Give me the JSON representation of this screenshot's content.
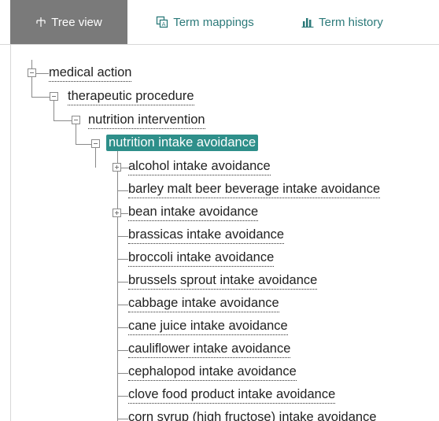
{
  "tabs": [
    {
      "label": "Tree view",
      "icon": "tree-icon",
      "active": true
    },
    {
      "label": "Term mappings",
      "icon": "mapping-icon",
      "active": false
    },
    {
      "label": "Term history",
      "icon": "history-chart-icon",
      "active": false
    }
  ],
  "colors": {
    "active_tab_bg": "#7a7a7a",
    "tab_text": "#2c7a7a",
    "selected_bg": "#2e8f8a"
  },
  "tree": {
    "ancestors": [
      "medical action",
      "therapeutic procedure",
      "nutrition intervention"
    ],
    "selected": "nutrition intake avoidance",
    "children": [
      {
        "label": "alcohol intake avoidance",
        "expandable": true
      },
      {
        "label": "barley malt beer beverage intake avoidance",
        "expandable": false
      },
      {
        "label": "bean intake avoidance",
        "expandable": true
      },
      {
        "label": "brassicas intake avoidance",
        "expandable": false
      },
      {
        "label": "broccoli intake avoidance",
        "expandable": false
      },
      {
        "label": "brussels sprout intake avoidance",
        "expandable": false
      },
      {
        "label": "cabbage intake avoidance",
        "expandable": false
      },
      {
        "label": "cane juice intake avoidance",
        "expandable": false
      },
      {
        "label": "cauliflower intake avoidance",
        "expandable": false
      },
      {
        "label": "cephalopod intake avoidance",
        "expandable": false
      },
      {
        "label": "clove food product intake avoidance",
        "expandable": false
      },
      {
        "label": "corn syrup (high fructose) intake avoidance",
        "expandable": false
      }
    ]
  }
}
